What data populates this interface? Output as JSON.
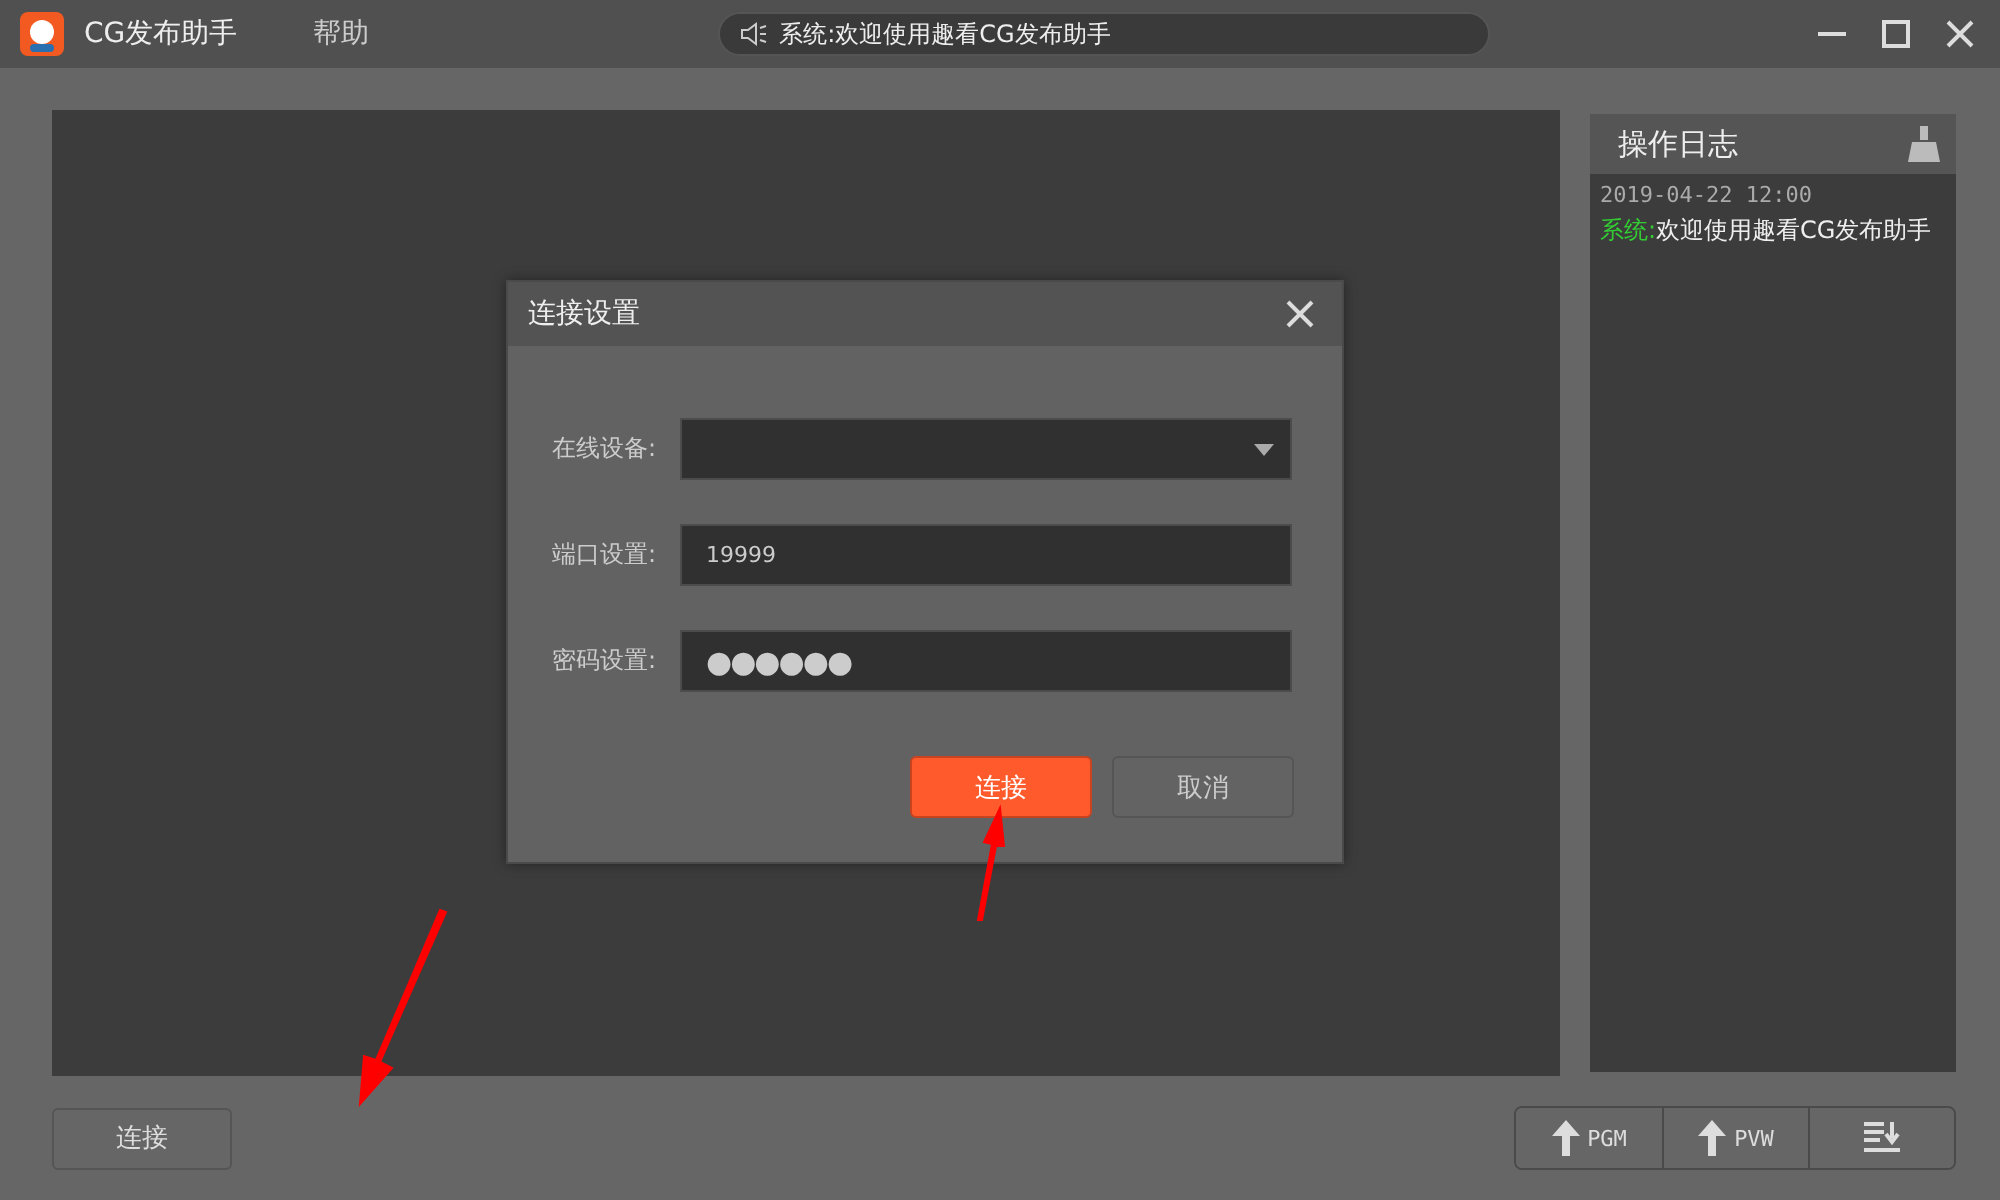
{
  "app": {
    "title": "CG发布助手",
    "menu": [
      "帮助"
    ]
  },
  "notice": {
    "text": "系统:欢迎使用趣看CG发布助手"
  },
  "log": {
    "title": "操作日志",
    "entries": [
      {
        "time": "2019-04-22 12:00",
        "source": "系统:",
        "message": "欢迎使用趣看CG发布助手"
      }
    ]
  },
  "dialog": {
    "title": "连接设置",
    "fields": [
      {
        "kind": "select",
        "label": "在线设备:"
      },
      {
        "kind": "text",
        "label": "端口设置:",
        "value": "19999"
      },
      {
        "kind": "password",
        "label": "密码设置:",
        "value": "●●●●●●"
      }
    ],
    "buttons": [
      {
        "label": "连接",
        "primary": true
      },
      {
        "label": "取消",
        "primary": false
      }
    ]
  },
  "bottom": {
    "connect": "连接",
    "publish": [
      {
        "kind": "upload",
        "label": "PGM"
      },
      {
        "kind": "upload",
        "label": "PVW"
      },
      {
        "kind": "sort"
      }
    ]
  }
}
